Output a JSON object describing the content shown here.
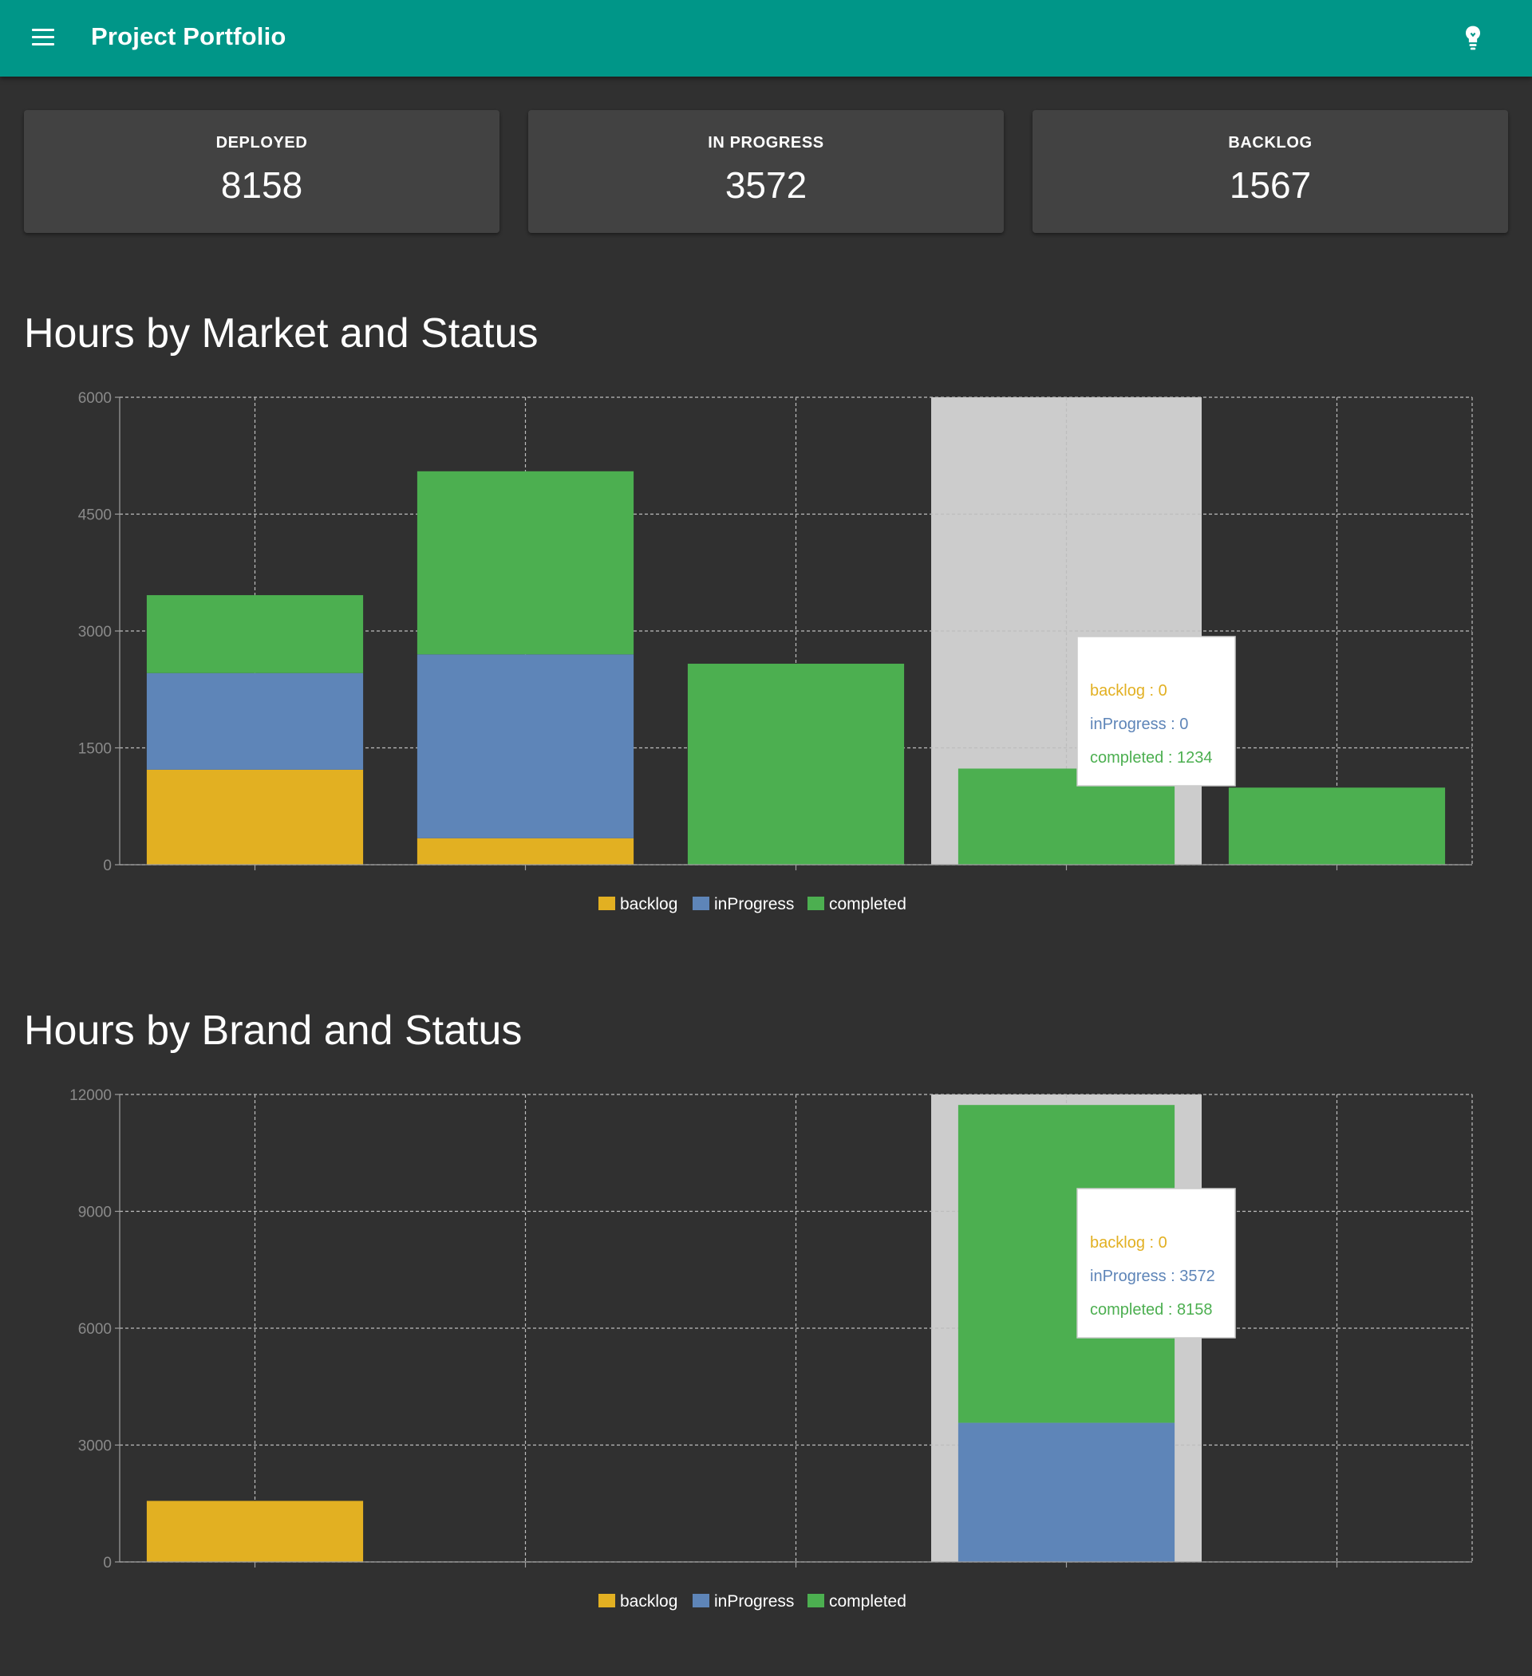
{
  "header": {
    "title": "Project Portfolio",
    "menu_icon": "menu-icon",
    "theme_icon": "lightbulb-icon",
    "color": "#009688"
  },
  "cards": [
    {
      "label": "DEPLOYED",
      "value": "8158"
    },
    {
      "label": "IN PROGRESS",
      "value": "3572"
    },
    {
      "label": "BACKLOG",
      "value": "1567"
    }
  ],
  "colors": {
    "backlog": "#E2B022",
    "inProgress": "#5E85B8",
    "completed": "#4CAF50",
    "highlight": "#CCCCCC",
    "background": "#303030",
    "card": "#424242"
  },
  "chart_data": [
    {
      "type": "bar",
      "stacked": true,
      "title": "Hours by Market and Status",
      "categories": [
        "",
        "",
        "",
        "",
        ""
      ],
      "ylim": [
        0,
        6000
      ],
      "yticks": [
        0,
        1500,
        3000,
        4500,
        6000
      ],
      "grid": true,
      "legend_position": "bottom",
      "series": [
        {
          "name": "backlog",
          "values": [
            1220,
            340,
            0,
            0,
            0
          ]
        },
        {
          "name": "inProgress",
          "values": [
            1240,
            2360,
            0,
            0,
            0
          ]
        },
        {
          "name": "completed",
          "values": [
            1000,
            2350,
            2580,
            1234,
            990
          ]
        }
      ],
      "highlight_index": 3,
      "tooltip": {
        "lines": [
          "backlog : 0",
          "inProgress : 0",
          "completed : 1234"
        ]
      }
    },
    {
      "type": "bar",
      "stacked": true,
      "title": "Hours by Brand and Status",
      "categories": [
        "",
        "",
        "",
        "",
        ""
      ],
      "ylim": [
        0,
        12000
      ],
      "yticks": [
        0,
        3000,
        6000,
        9000,
        12000
      ],
      "grid": true,
      "legend_position": "bottom",
      "series": [
        {
          "name": "backlog",
          "values": [
            1567,
            0,
            0,
            0,
            0
          ]
        },
        {
          "name": "inProgress",
          "values": [
            0,
            0,
            0,
            3572,
            0
          ]
        },
        {
          "name": "completed",
          "values": [
            0,
            0,
            0,
            8158,
            0
          ]
        }
      ],
      "highlight_index": 3,
      "tooltip": {
        "lines": [
          "backlog : 0",
          "inProgress : 3572",
          "completed : 8158"
        ]
      }
    }
  ]
}
